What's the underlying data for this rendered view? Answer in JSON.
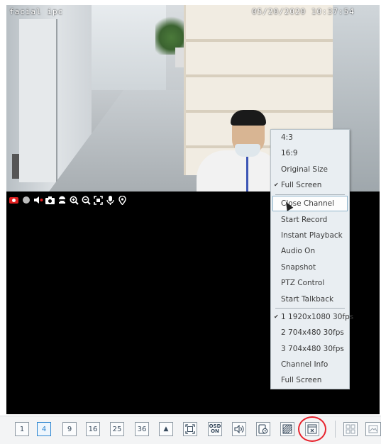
{
  "osd": {
    "channel_name": "facial ipc",
    "timestamp": "05/20/2020 10:37:54"
  },
  "channel_toolbar": {
    "icons": [
      "record-icon",
      "stop-icon",
      "audio-mute-icon",
      "snapshot-icon",
      "ptz-icon",
      "zoom-in-icon",
      "zoom-out-icon",
      "fullscreen-icon",
      "talkback-icon",
      "location-icon"
    ]
  },
  "context_menu": {
    "items": [
      {
        "label": "4:3",
        "checked": false
      },
      {
        "label": "16:9",
        "checked": false
      },
      {
        "label": "Original Size",
        "checked": false
      },
      {
        "label": "Full Screen",
        "checked": true
      },
      {
        "label": "Close Channel",
        "checked": false,
        "hover": true
      },
      {
        "label": "Start Record",
        "checked": false
      },
      {
        "label": "Instant Playback",
        "checked": false
      },
      {
        "label": "Audio On",
        "checked": false
      },
      {
        "label": "Snapshot",
        "checked": false
      },
      {
        "label": "PTZ Control",
        "checked": false
      },
      {
        "label": "Start Talkback",
        "checked": false
      },
      {
        "label": "1 1920x1080 30fps",
        "checked": true
      },
      {
        "label": "2 704x480 30fps",
        "checked": false
      },
      {
        "label": "3 704x480 30fps",
        "checked": false
      },
      {
        "label": "Channel Info",
        "checked": false
      },
      {
        "label": "Full Screen",
        "checked": false
      }
    ]
  },
  "bottom_toolbar": {
    "layout_1": "1",
    "layout_4": "4",
    "layout_9": "9",
    "layout_16": "16",
    "layout_25": "25",
    "layout_36": "36",
    "osd_top": "OSD",
    "osd_bottom": "ON"
  },
  "colors": {
    "active_blue": "#2e86d0",
    "highlight_red": "#e8232d"
  }
}
